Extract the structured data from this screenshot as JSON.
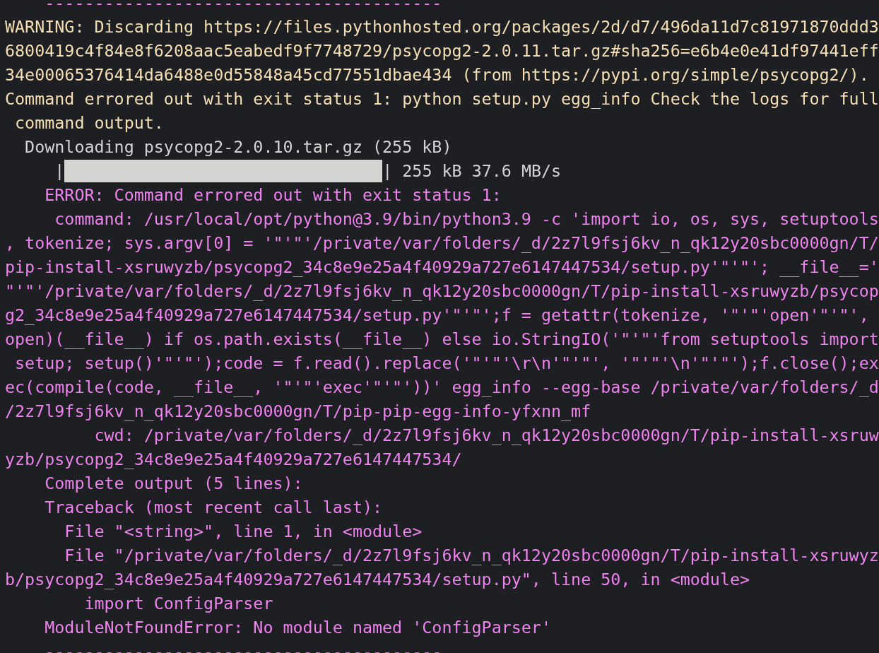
{
  "terminal": {
    "lines": [
      {
        "kind": "error",
        "text": "    ----------------------------------------"
      },
      {
        "kind": "warning",
        "text": "WARNING: Discarding https://files.pythonhosted.org/packages/2d/d7/496da11d7c81971870ddd3"
      },
      {
        "kind": "warning",
        "text": "6800419c4f84e8f6208aac5eabedf9f7748729/psycopg2-2.0.11.tar.gz#sha256=e6b4e0e41df97441eff"
      },
      {
        "kind": "warning",
        "text": "34e00065376414da6488e0d55848a45cd77551dbae434 (from https://pypi.org/simple/psycopg2/)."
      },
      {
        "kind": "warning",
        "text": "Command errored out with exit status 1: python setup.py egg_info Check the logs for full"
      },
      {
        "kind": "warning",
        "text": " command output."
      },
      {
        "kind": "normal",
        "text": "  Downloading psycopg2-2.0.10.tar.gz (255 kB)"
      },
      {
        "kind": "progress",
        "left": "|",
        "level": 1,
        "right": "|",
        "reading": "255 kB 37.6 MB/s"
      },
      {
        "kind": "error",
        "text": "    ERROR: Command errored out with exit status 1:"
      },
      {
        "kind": "error",
        "text": "     command: /usr/local/opt/python@3.9/bin/python3.9 -c 'import io, os, sys, setuptools"
      },
      {
        "kind": "error",
        "text": ", tokenize; sys.argv[0] = '\"'\"'/private/var/folders/_d/2z7l9fsj6kv_n_qk12y20sbc0000gn/T/"
      },
      {
        "kind": "error",
        "text": "pip-install-xsruwyzb/psycopg2_34c8e9e25a4f40929a727e6147447534/setup.py'\"'\"'; __file__='"
      },
      {
        "kind": "error",
        "text": "\"'\"'/private/var/folders/_d/2z7l9fsj6kv_n_qk12y20sbc0000gn/T/pip-install-xsruwyzb/psycop"
      },
      {
        "kind": "error",
        "text": "g2_34c8e9e25a4f40929a727e6147447534/setup.py'\"'\"';f = getattr(tokenize, '\"'\"'open'\"'\"',"
      },
      {
        "kind": "error",
        "text": "open)(__file__) if os.path.exists(__file__) else io.StringIO('\"'\"'from setuptools import"
      },
      {
        "kind": "error",
        "text": " setup; setup()'\"'\"');code = f.read().replace('\"'\"'\\r\\n'\"'\"', '\"'\"'\\n'\"'\"');f.close();ex"
      },
      {
        "kind": "error",
        "text": "ec(compile(code, __file__, '\"'\"'exec'\"'\"'))' egg_info --egg-base /private/var/folders/_d"
      },
      {
        "kind": "error",
        "text": "/2z7l9fsj6kv_n_qk12y20sbc0000gn/T/pip-pip-egg-info-yfxnn_mf"
      },
      {
        "kind": "error",
        "text": "         cwd: /private/var/folders/_d/2z7l9fsj6kv_n_qk12y20sbc0000gn/T/pip-install-xsruw"
      },
      {
        "kind": "error",
        "text": "yzb/psycopg2_34c8e9e25a4f40929a727e6147447534/"
      },
      {
        "kind": "error",
        "text": "    Complete output (5 lines):"
      },
      {
        "kind": "error",
        "text": "    Traceback (most recent call last):"
      },
      {
        "kind": "error",
        "text": "      File \"<string>\", line 1, in <module>"
      },
      {
        "kind": "error",
        "text": "      File \"/private/var/folders/_d/2z7l9fsj6kv_n_qk12y20sbc0000gn/T/pip-install-xsruwyz"
      },
      {
        "kind": "error",
        "text": "b/psycopg2_34c8e9e25a4f40929a727e6147447534/setup.py\", line 50, in <module>"
      },
      {
        "kind": "error",
        "text": "        import ConfigParser"
      },
      {
        "kind": "error",
        "text": "    ModuleNotFoundError: No module named 'ConfigParser'"
      },
      {
        "kind": "error",
        "text": "    ----------------------------------------"
      }
    ]
  }
}
